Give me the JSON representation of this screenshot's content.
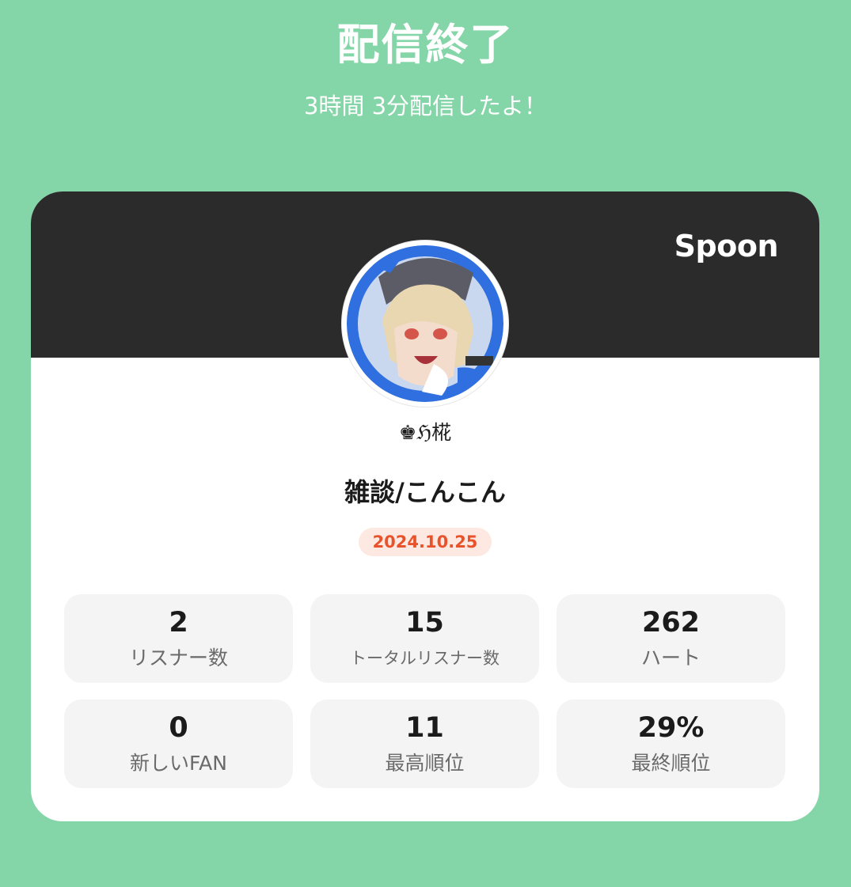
{
  "header": {
    "title": "配信終了",
    "subtitle": "3時間 3分配信したよ！"
  },
  "card": {
    "brand": "Spoon",
    "host_name": "♚ℌ椛",
    "live_title": "雑談/こんこん",
    "date": "2024.10.25",
    "colors": {
      "background": "#84d5a7",
      "card_top": "#2b2b2b",
      "date_badge_bg": "#fde9e1",
      "date_badge_text": "#e8532b"
    }
  },
  "stats": [
    {
      "value": "2",
      "label": "リスナー数"
    },
    {
      "value": "15",
      "label": "トータルリスナー数"
    },
    {
      "value": "262",
      "label": "ハート"
    },
    {
      "value": "0",
      "label": "新しいFAN"
    },
    {
      "value": "11",
      "label": "最高順位"
    },
    {
      "value": "29%",
      "label": "最終順位"
    }
  ]
}
